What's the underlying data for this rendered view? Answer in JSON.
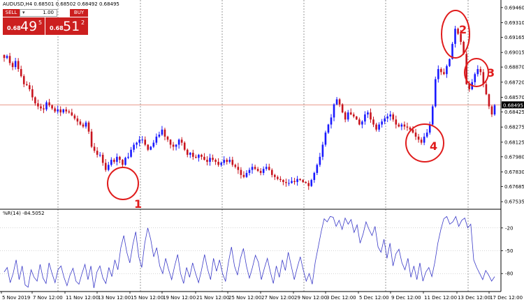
{
  "symbol_line": "AUDUSD,H4  0.68501 0.68502 0.68492 0.68495",
  "trade_panel": {
    "sell_label": "SELL",
    "lot_value": "1.00",
    "lot_arrow": "▾",
    "buy_label": "BUY",
    "sell_prefix": "0.68",
    "sell_big": "49",
    "sell_sup": "5",
    "buy_prefix": "0.68",
    "buy_big": "51",
    "buy_sup": "2"
  },
  "indicator_label": "%R(14) -84.5052",
  "chart_data": [
    {
      "type": "candlestick",
      "title": "AUDUSD,H4",
      "price_ticks": [
        "0.69460",
        "0.69310",
        "0.69165",
        "0.69015",
        "0.68870",
        "0.68720",
        "0.68570",
        "0.68425",
        "0.68275",
        "0.68125",
        "0.67980",
        "0.67830",
        "0.67685",
        "0.67535"
      ],
      "ylim": [
        0.6746,
        0.69535
      ],
      "current_price": "0.68495",
      "x_labels": [
        "5 Nov 2019",
        "7 Nov 12:00",
        "11 Nov 12:00",
        "13 Nov 12:00",
        "15 Nov 12:00",
        "19 Nov 12:00",
        "21 Nov 12:00",
        "25 Nov 12:00",
        "27 Nov 12:00",
        "29 Nov 12:00",
        "3 Dec 12:00",
        "5 Dec 12:00",
        "9 Dec 12:00",
        "11 Dec 12:00",
        "13 Dec 12:00",
        "17 Dec 12:00"
      ],
      "annotations": [
        "1",
        "2",
        "3",
        "4"
      ],
      "colors": {
        "up": "#1a1aff",
        "down": "#c8141e",
        "current_line": "#e89a8a",
        "annotation": "#e01c1c"
      },
      "close_path": [
        0.6896,
        0.6898,
        0.6891,
        0.6887,
        0.6893,
        0.6885,
        0.6878,
        0.687,
        0.6869,
        0.6865,
        0.6857,
        0.6851,
        0.6848,
        0.6846,
        0.6845,
        0.6852,
        0.6849,
        0.6846,
        0.6843,
        0.6845,
        0.6842,
        0.6845,
        0.6843,
        0.6842,
        0.6839,
        0.6836,
        0.6833,
        0.683,
        0.6828,
        0.6832,
        0.6823,
        0.6808,
        0.6804,
        0.68,
        0.68,
        0.6792,
        0.6785,
        0.679,
        0.6795,
        0.6793,
        0.6798,
        0.6795,
        0.679,
        0.6797,
        0.6798,
        0.6805,
        0.681,
        0.6812,
        0.6815,
        0.6815,
        0.681,
        0.6805,
        0.6808,
        0.6812,
        0.6818,
        0.682,
        0.6825,
        0.6818,
        0.6815,
        0.681,
        0.6808,
        0.681,
        0.6815,
        0.6812,
        0.6805,
        0.68,
        0.6802,
        0.6798,
        0.6797,
        0.68,
        0.6798,
        0.6795,
        0.6793,
        0.6797,
        0.6795,
        0.6793,
        0.679,
        0.6792,
        0.6795,
        0.6793,
        0.6795,
        0.679,
        0.6788,
        0.6785,
        0.678,
        0.6778,
        0.6782,
        0.6785,
        0.6788,
        0.6786,
        0.6784,
        0.6782,
        0.6786,
        0.6788,
        0.6785,
        0.678,
        0.6778,
        0.6776,
        0.6775,
        0.6773,
        0.6772,
        0.6772,
        0.6774,
        0.6773,
        0.6776,
        0.6775,
        0.6773,
        0.6772,
        0.6769,
        0.6775,
        0.6782,
        0.679,
        0.6798,
        0.681,
        0.6822,
        0.683,
        0.6837,
        0.685,
        0.6855,
        0.685,
        0.6842,
        0.6835,
        0.6842,
        0.684,
        0.6838,
        0.6835,
        0.683,
        0.6833,
        0.684,
        0.6842,
        0.6835,
        0.683,
        0.6825,
        0.683,
        0.6833,
        0.6836,
        0.6838,
        0.684,
        0.6835,
        0.683,
        0.6828,
        0.683,
        0.6828,
        0.6827,
        0.6825,
        0.6822,
        0.6818,
        0.6815,
        0.6812,
        0.6818,
        0.6822,
        0.683,
        0.6848,
        0.6875,
        0.6885,
        0.6882,
        0.688,
        0.6888,
        0.6895,
        0.691,
        0.6925,
        0.692,
        0.6912,
        0.69,
        0.687,
        0.6865,
        0.6872,
        0.688,
        0.6885,
        0.6882,
        0.687,
        0.686,
        0.6848,
        0.684,
        0.6849
      ]
    },
    {
      "type": "line",
      "title": "%R(14)",
      "indicator_value": "-84.5052",
      "y_ticks": [
        "-20",
        "-50",
        "-80"
      ],
      "ylim": [
        -100,
        0
      ],
      "colors": {
        "line": "#3a3ac8"
      },
      "values": [
        -78,
        -72,
        -92,
        -80,
        -62,
        -88,
        -70,
        -95,
        -98,
        -75,
        -85,
        -90,
        -68,
        -86,
        -93,
        -66,
        -80,
        -92,
        -75,
        -70,
        -85,
        -96,
        -82,
        -73,
        -90,
        -94,
        -80,
        -68,
        -88,
        -70,
        -99,
        -78,
        -70,
        -86,
        -93,
        -72,
        -84,
        -62,
        -75,
        -46,
        -30,
        -52,
        -66,
        -42,
        -25,
        -58,
        -72,
        -40,
        -20,
        -35,
        -58,
        -46,
        -70,
        -80,
        -60,
        -75,
        -88,
        -70,
        -55,
        -80,
        -93,
        -72,
        -85,
        -66,
        -80,
        -92,
        -75,
        -55,
        -74,
        -88,
        -60,
        -77,
        -62,
        -80,
        -90,
        -65,
        -45,
        -70,
        -82,
        -60,
        -47,
        -70,
        -86,
        -72,
        -56,
        -65,
        -88,
        -73,
        -60,
        -78,
        -93,
        -70,
        -85,
        -62,
        -76,
        -52,
        -70,
        -88,
        -72,
        -58,
        -75,
        -90,
        -80,
        -94,
        -65,
        -45,
        -25,
        -8,
        -12,
        -5,
        -6,
        -18,
        -10,
        -22,
        -7,
        -15,
        -9,
        -26,
        -16,
        -40,
        -28,
        -12,
        -22,
        -30,
        -18,
        -45,
        -52,
        -35,
        -60,
        -40,
        -70,
        -54,
        -48,
        -66,
        -75,
        -60,
        -85,
        -70,
        -88,
        -66,
        -90,
        -78,
        -72,
        -84,
        -65,
        -40,
        -22,
        -8,
        -5,
        -15,
        -12,
        -5,
        -18,
        -10,
        -7,
        -20,
        -15,
        -62,
        -72,
        -80,
        -88,
        -76,
        -82,
        -90,
        -84
      ]
    }
  ]
}
